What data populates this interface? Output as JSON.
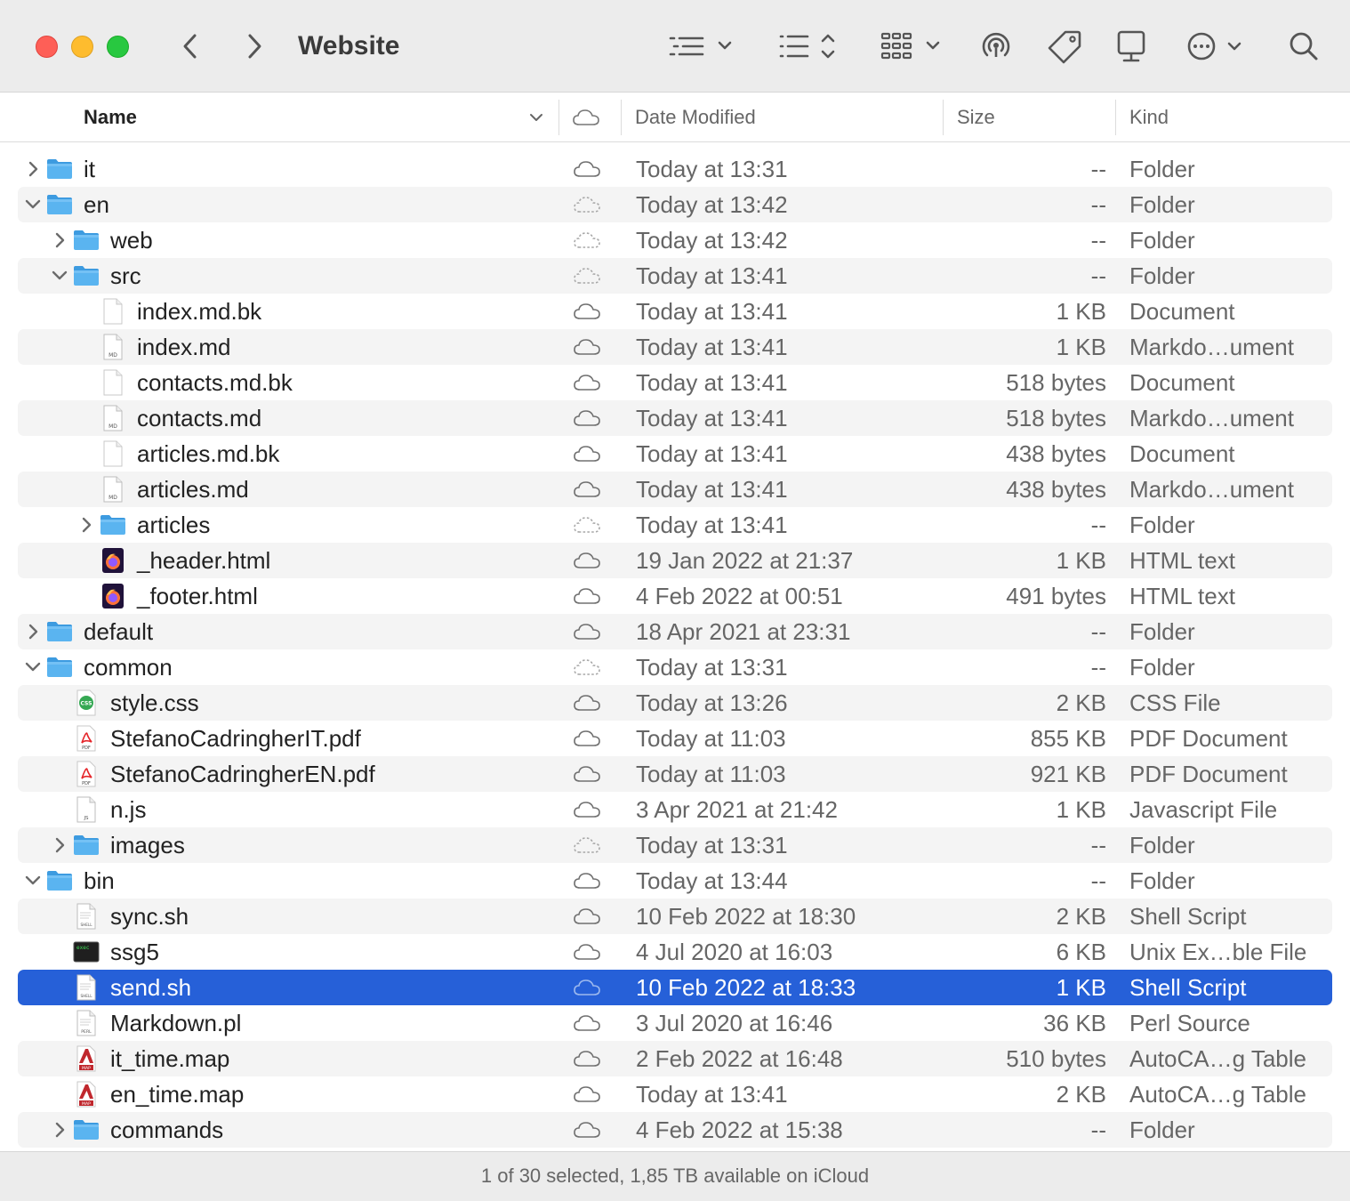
{
  "window": {
    "title": "Website"
  },
  "toolbar": {
    "icons": [
      "chevron-left-icon",
      "chevron-right-icon",
      "list-view-icon",
      "sort-icon",
      "gallery-grid-icon",
      "airdrop-icon",
      "tag-icon",
      "device-icon",
      "more-icon",
      "search-icon"
    ]
  },
  "columns": {
    "name": "Name",
    "date": "Date Modified",
    "size": "Size",
    "kind": "Kind"
  },
  "rows": [
    {
      "name": "it",
      "date": "Today at 13:31",
      "size": "--",
      "kind": "Folder",
      "depth": 0,
      "disclosure": "collapsed",
      "icon": "folder",
      "cloud": "solid"
    },
    {
      "name": "en",
      "date": "Today at 13:42",
      "size": "--",
      "kind": "Folder",
      "depth": 0,
      "disclosure": "expanded",
      "icon": "folder",
      "cloud": "dashed"
    },
    {
      "name": "web",
      "date": "Today at 13:42",
      "size": "--",
      "kind": "Folder",
      "depth": 1,
      "disclosure": "collapsed",
      "icon": "folder",
      "cloud": "dashed"
    },
    {
      "name": "src",
      "date": "Today at 13:41",
      "size": "--",
      "kind": "Folder",
      "depth": 1,
      "disclosure": "expanded",
      "icon": "folder",
      "cloud": "dashed"
    },
    {
      "name": "index.md.bk",
      "date": "Today at 13:41",
      "size": "1 KB",
      "kind": "Document",
      "depth": 2,
      "disclosure": "none",
      "icon": "doc",
      "cloud": "solid"
    },
    {
      "name": "index.md",
      "date": "Today at 13:41",
      "size": "1 KB",
      "kind": "Markdo…ument",
      "depth": 2,
      "disclosure": "none",
      "icon": "md",
      "cloud": "solid"
    },
    {
      "name": "contacts.md.bk",
      "date": "Today at 13:41",
      "size": "518 bytes",
      "kind": "Document",
      "depth": 2,
      "disclosure": "none",
      "icon": "doc",
      "cloud": "solid"
    },
    {
      "name": "contacts.md",
      "date": "Today at 13:41",
      "size": "518 bytes",
      "kind": "Markdo…ument",
      "depth": 2,
      "disclosure": "none",
      "icon": "md",
      "cloud": "solid"
    },
    {
      "name": "articles.md.bk",
      "date": "Today at 13:41",
      "size": "438 bytes",
      "kind": "Document",
      "depth": 2,
      "disclosure": "none",
      "icon": "doc",
      "cloud": "solid"
    },
    {
      "name": "articles.md",
      "date": "Today at 13:41",
      "size": "438 bytes",
      "kind": "Markdo…ument",
      "depth": 2,
      "disclosure": "none",
      "icon": "md",
      "cloud": "solid"
    },
    {
      "name": "articles",
      "date": "Today at 13:41",
      "size": "--",
      "kind": "Folder",
      "depth": 2,
      "disclosure": "collapsed",
      "icon": "folder",
      "cloud": "dashed"
    },
    {
      "name": "_header.html",
      "date": "19 Jan 2022 at 21:37",
      "size": "1 KB",
      "kind": "HTML text",
      "depth": 2,
      "disclosure": "none",
      "icon": "firefox",
      "cloud": "solid"
    },
    {
      "name": "_footer.html",
      "date": "4 Feb 2022 at 00:51",
      "size": "491 bytes",
      "kind": "HTML text",
      "depth": 2,
      "disclosure": "none",
      "icon": "firefox",
      "cloud": "solid"
    },
    {
      "name": "default",
      "date": "18 Apr 2021 at 23:31",
      "size": "--",
      "kind": "Folder",
      "depth": 0,
      "disclosure": "collapsed",
      "icon": "folder",
      "cloud": "solid"
    },
    {
      "name": "common",
      "date": "Today at 13:31",
      "size": "--",
      "kind": "Folder",
      "depth": 0,
      "disclosure": "expanded",
      "icon": "folder",
      "cloud": "dashed"
    },
    {
      "name": "style.css",
      "date": "Today at 13:26",
      "size": "2 KB",
      "kind": "CSS File",
      "depth": 1,
      "disclosure": "none",
      "icon": "css",
      "cloud": "solid"
    },
    {
      "name": "StefanoCadringherIT.pdf",
      "date": "Today at 11:03",
      "size": "855 KB",
      "kind": "PDF Document",
      "depth": 1,
      "disclosure": "none",
      "icon": "pdf",
      "cloud": "solid"
    },
    {
      "name": "StefanoCadringherEN.pdf",
      "date": "Today at 11:03",
      "size": "921 KB",
      "kind": "PDF Document",
      "depth": 1,
      "disclosure": "none",
      "icon": "pdf",
      "cloud": "solid"
    },
    {
      "name": "n.js",
      "date": "3 Apr 2021 at 21:42",
      "size": "1 KB",
      "kind": "Javascript File",
      "depth": 1,
      "disclosure": "none",
      "icon": "js",
      "cloud": "solid"
    },
    {
      "name": "images",
      "date": "Today at 13:31",
      "size": "--",
      "kind": "Folder",
      "depth": 1,
      "disclosure": "collapsed",
      "icon": "folder",
      "cloud": "dashed"
    },
    {
      "name": "bin",
      "date": "Today at 13:44",
      "size": "--",
      "kind": "Folder",
      "depth": 0,
      "disclosure": "expanded",
      "icon": "folder",
      "cloud": "solid"
    },
    {
      "name": "sync.sh",
      "date": "10 Feb 2022 at 18:30",
      "size": "2 KB",
      "kind": "Shell Script",
      "depth": 1,
      "disclosure": "none",
      "icon": "shell",
      "cloud": "solid"
    },
    {
      "name": "ssg5",
      "date": "4 Jul 2020 at 16:03",
      "size": "6 KB",
      "kind": "Unix Ex…ble File",
      "depth": 1,
      "disclosure": "none",
      "icon": "exec",
      "cloud": "solid"
    },
    {
      "name": "send.sh",
      "date": "10 Feb 2022 at 18:33",
      "size": "1 KB",
      "kind": "Shell Script",
      "depth": 1,
      "disclosure": "none",
      "icon": "shell",
      "cloud": "solid",
      "selected": true
    },
    {
      "name": "Markdown.pl",
      "date": "3 Jul 2020 at 16:46",
      "size": "36 KB",
      "kind": "Perl Source",
      "depth": 1,
      "disclosure": "none",
      "icon": "perl",
      "cloud": "solid"
    },
    {
      "name": "it_time.map",
      "date": "2 Feb 2022 at 16:48",
      "size": "510 bytes",
      "kind": "AutoCA…g Table",
      "depth": 1,
      "disclosure": "none",
      "icon": "map",
      "cloud": "solid"
    },
    {
      "name": "en_time.map",
      "date": "Today at 13:41",
      "size": "2 KB",
      "kind": "AutoCA…g Table",
      "depth": 1,
      "disclosure": "none",
      "icon": "map",
      "cloud": "solid"
    },
    {
      "name": "commands",
      "date": "4 Feb 2022 at 15:38",
      "size": "--",
      "kind": "Folder",
      "depth": 1,
      "disclosure": "collapsed",
      "icon": "folder",
      "cloud": "solid"
    }
  ],
  "status": {
    "text": "1 of 30 selected, 1,85 TB available on iCloud"
  },
  "colors": {
    "selection": "#2660d8",
    "folder": "#5ab4f0",
    "close": "#fe5f57",
    "minimize": "#febc2e",
    "zoom": "#28c840"
  }
}
